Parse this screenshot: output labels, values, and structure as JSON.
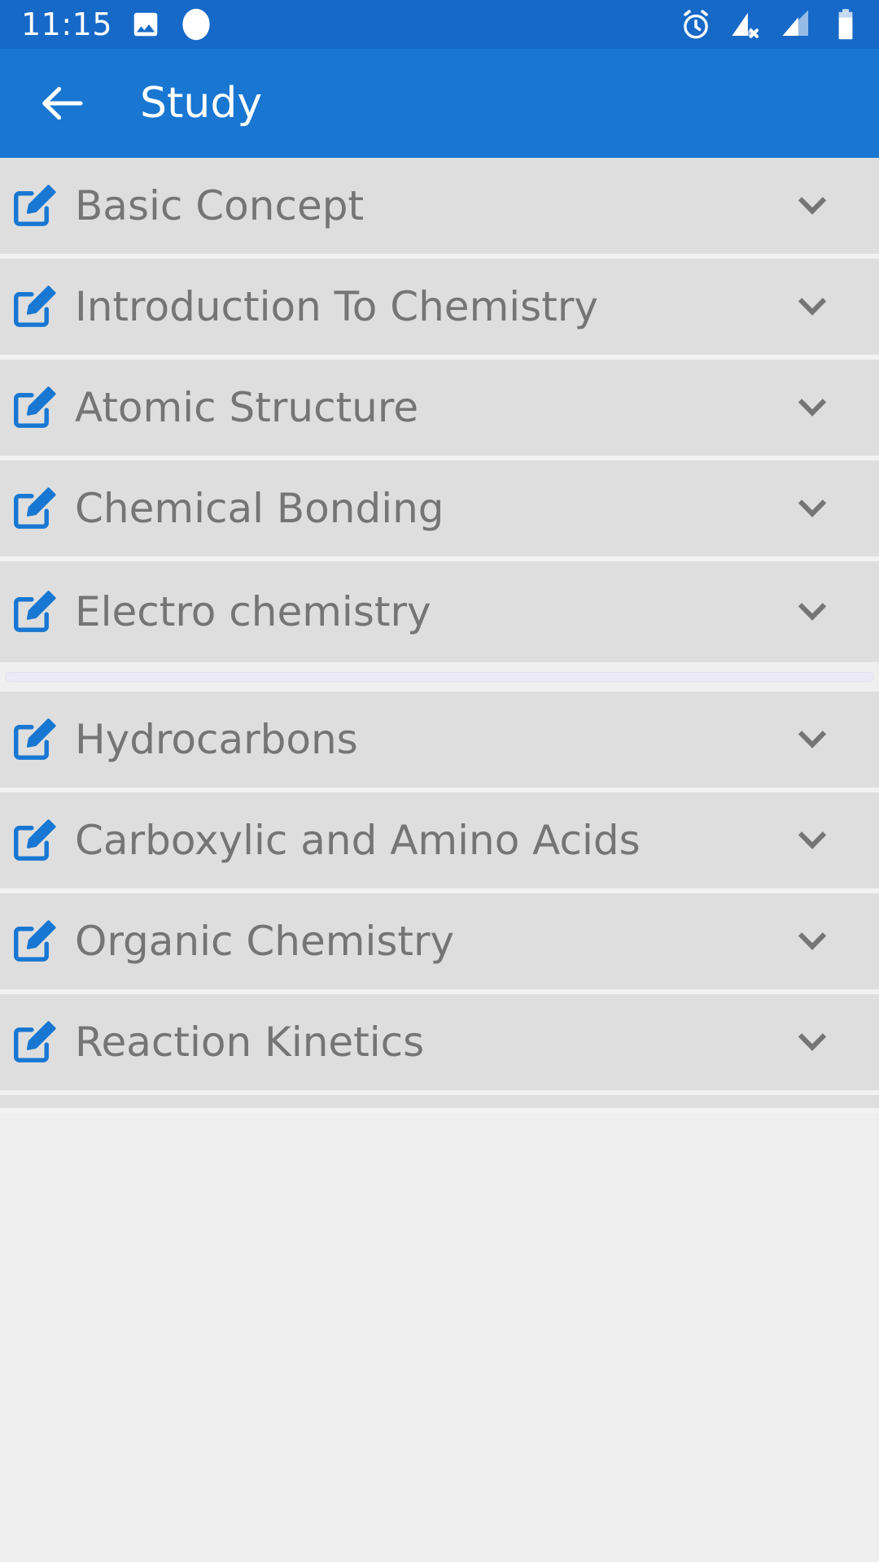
{
  "status_bar": {
    "time": "11:15",
    "background_color": "#1769c7",
    "icons_left": [
      "image-icon",
      "circle-icon"
    ],
    "icons_right": [
      "alarm-icon",
      "signal-no-sim-icon",
      "signal-bars-icon",
      "battery-icon"
    ]
  },
  "app_bar": {
    "title": "Study",
    "back_icon": "arrow-back-icon",
    "background_color": "#1977d2",
    "text_color": "#ffffff"
  },
  "list": {
    "item_background": "#dedede",
    "label_color": "#757575",
    "icon_color": "#1877d2",
    "chevron_icon": "chevron-down-icon",
    "item_icon": "edit-note-icon",
    "items": [
      {
        "label": "Basic Concept"
      },
      {
        "label": "Introduction To Chemistry"
      },
      {
        "label": "Atomic Structure"
      },
      {
        "label": "Chemical Bonding"
      },
      {
        "label": "Electro chemistry"
      },
      {
        "label": "Hydrocarbons"
      },
      {
        "label": "Carboxylic and Amino Acids"
      },
      {
        "label": "Organic Chemistry"
      },
      {
        "label": "Reaction Kinetics"
      }
    ]
  },
  "progress_bar": {
    "name": "loading-progress-bar",
    "track_color": "#eceaf6",
    "after_item_index": 4
  },
  "page_background": "#efefef"
}
